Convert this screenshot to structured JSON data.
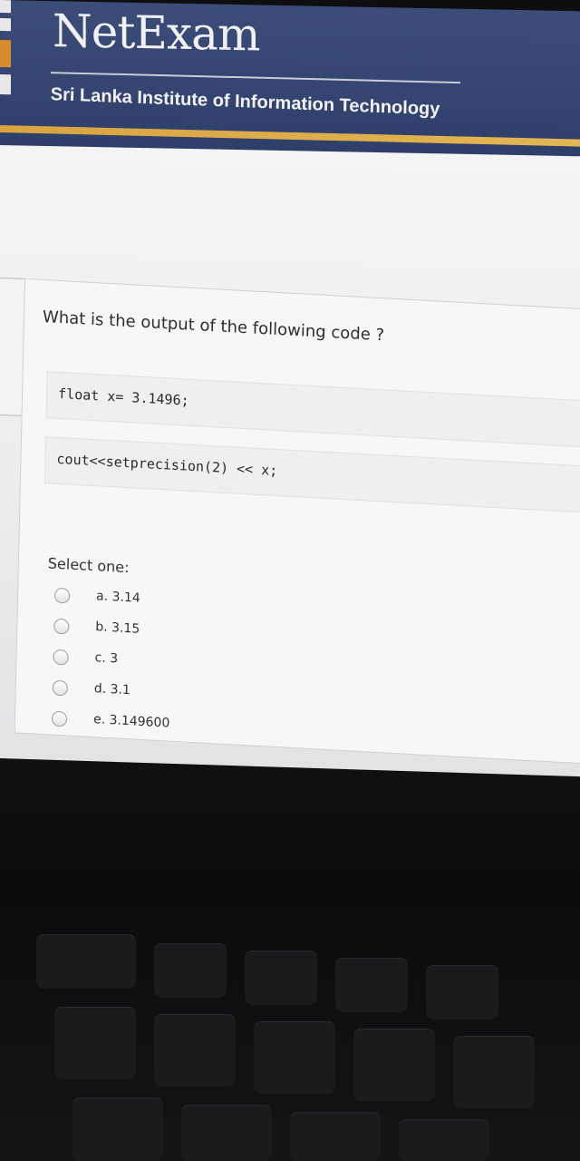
{
  "header": {
    "brand": "NetExam",
    "institute": "Sri Lanka Institute of Information Technology"
  },
  "question": {
    "prompt": "What is the output of the following code ?",
    "code_lines": [
      "float x= 3.1496;",
      "cout<<setprecision(2) << x;"
    ],
    "select_label": "Select one:",
    "options": [
      {
        "label": "a. 3.14"
      },
      {
        "label": "b. 3.15"
      },
      {
        "label": "c. 3"
      },
      {
        "label": "d. 3.1"
      },
      {
        "label": "e. 3.149600"
      }
    ]
  }
}
